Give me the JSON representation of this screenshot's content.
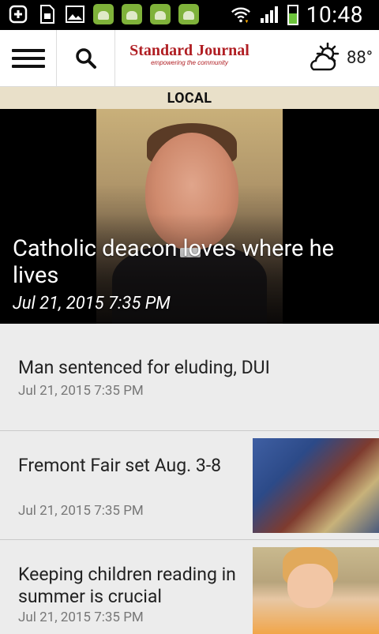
{
  "status_bar": {
    "time": "10:48"
  },
  "header": {
    "brand_name": "Standard Journal",
    "brand_tagline": "empowering the community",
    "temperature": "88°"
  },
  "section": {
    "title": "LOCAL"
  },
  "hero": {
    "headline": "Catholic deacon loves where he lives",
    "date": "Jul 21, 2015 7:35 PM"
  },
  "articles": [
    {
      "title": "Man sentenced for eluding, DUI",
      "date": "Jul 21, 2015 7:35 PM"
    },
    {
      "title": "Fremont Fair set Aug. 3-8",
      "date": "Jul 21, 2015 7:35 PM"
    },
    {
      "title": "Keeping children reading in summer is crucial",
      "date": "Jul 21, 2015 7:35 PM"
    }
  ]
}
